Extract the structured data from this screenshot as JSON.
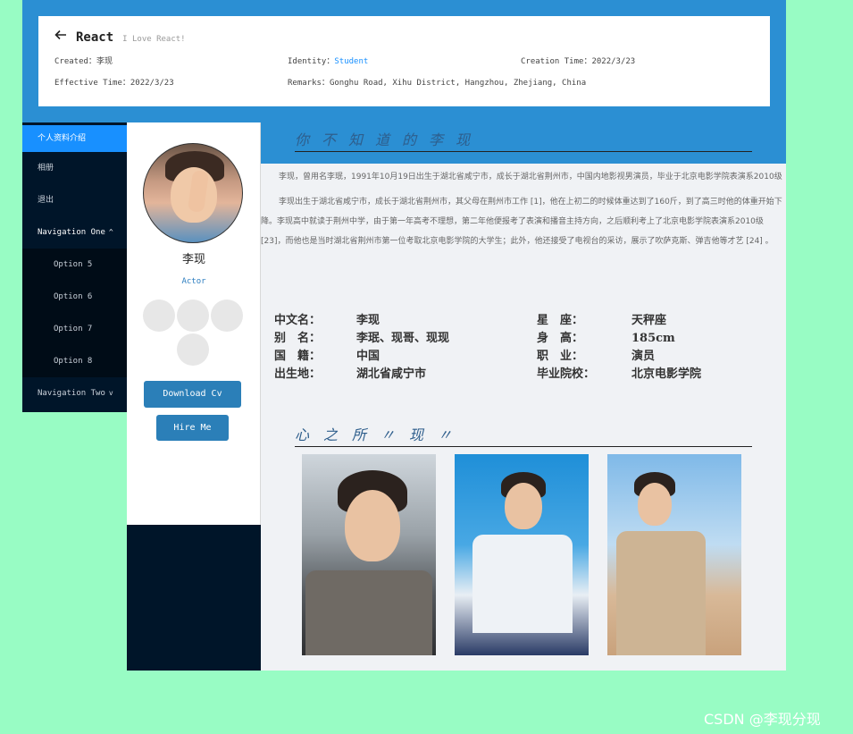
{
  "header": {
    "title": "React",
    "subtitle": "I Love React!",
    "created_label": "Created：",
    "created_value": "李现",
    "identity_label": "Identity：",
    "identity_value": "Student",
    "creation_time_label": "Creation Time：",
    "creation_time_value": "2022/3/23",
    "effective_time_label": "Effective Time：",
    "effective_time_value": "2022/3/23",
    "remarks_label": "Remarks：",
    "remarks_value": "Gonghu Road, Xihu District, Hangzhou, Zhejiang, China"
  },
  "nav": {
    "items": [
      "个人资料介绍",
      "相册",
      "退出"
    ],
    "group_one": "Navigation One",
    "group_one_options": [
      "Option 5",
      "Option 6",
      "Option 7",
      "Option 8"
    ],
    "group_two": "Navigation Two"
  },
  "profile": {
    "name": "李现",
    "role": "Actor",
    "social_icons": [
      "",
      "",
      "",
      ""
    ],
    "download_label": "Download Cv",
    "hire_label": "Hire Me"
  },
  "main": {
    "section1_title": "你不知道的李现",
    "bio_p1": "李现，曾用名李珉，1991年10月19日出生于湖北省咸宁市，成长于湖北省荆州市，中国内地影视男演员，毕业于北京电影学院表演系2010级",
    "bio_p2": "李现出生于湖北省咸宁市，成长于湖北省荆州市，其父母在荆州市工作 [1]，他在上初二的时候体重达到了160斤，到了高三时他的体重开始下降。李现高中就读于荆州中学，由于第一年高考不理想，第二年他便报考了表演和播音主持方向，之后顺利考上了北京电影学院表演系2010级 [23]，而他也是当时湖北省荆州市第一位考取北京电影学院的大学生；此外，他还接受了电视台的采访，展示了吹萨克斯、弹吉他等才艺 [24] 。",
    "facts": [
      {
        "k1": "中文名：",
        "v1": "李现",
        "k2": "星　座：",
        "v2": "天秤座"
      },
      {
        "k1": "别　名：",
        "v1": "李珉、现哥、现现",
        "k2": "身　高：",
        "v2": "185cm"
      },
      {
        "k1": "国　籍：",
        "v1": "中国",
        "k2": "职　业：",
        "v2": "演员"
      },
      {
        "k1": "出生地：",
        "v1": "湖北省咸宁市",
        "k2": "毕业院校：",
        "v2": "北京电影学院"
      }
    ],
    "section2_title": "心之所〃现〃"
  },
  "watermark": "CSDN @李现分现"
}
